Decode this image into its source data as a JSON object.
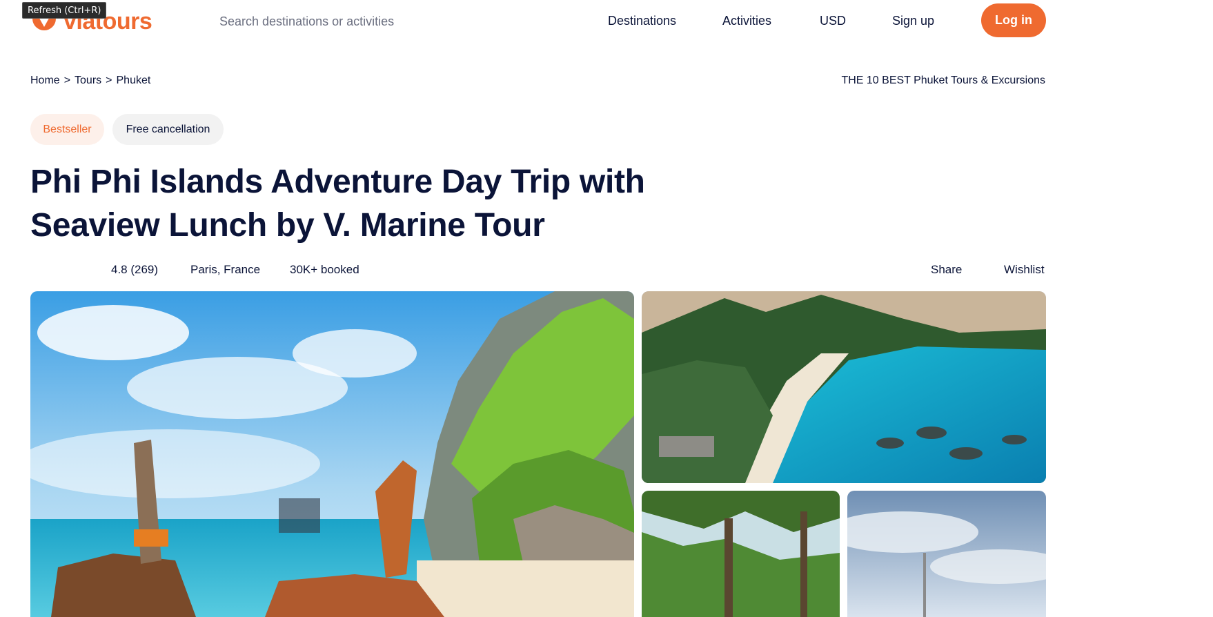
{
  "browser": {
    "tooltip": "Refresh (Ctrl+R)"
  },
  "header": {
    "logo_text": "viatours",
    "search_placeholder": "Search destinations or activities",
    "nav": {
      "destinations": "Destinations",
      "activities": "Activities",
      "currency": "USD",
      "signup": "Sign up",
      "login": "Log in"
    }
  },
  "breadcrumb": {
    "items": [
      "Home",
      "Tours",
      "Phuket"
    ],
    "separator": ">"
  },
  "top_link": "THE 10 BEST Phuket Tours & Excursions",
  "badges": {
    "bestseller": "Bestseller",
    "free_cancellation": "Free cancellation"
  },
  "tour": {
    "title": "Phi Phi Islands Adventure Day Trip with Seaview Lunch by V. Marine Tour",
    "rating_text": "4.8 (269)",
    "location": "Paris, France",
    "booked": "30K+ booked",
    "actions": {
      "share": "Share",
      "wishlist": "Wishlist"
    }
  },
  "colors": {
    "accent": "#ef6a30",
    "text": "#0b1438",
    "badge_best_bg": "#fdf0ea",
    "badge_free_bg": "#f2f2f2"
  },
  "gallery": [
    {
      "name": "main-photo",
      "subject": "longtail-boats-beach-cliff"
    },
    {
      "name": "top-right-photo",
      "subject": "aerial-beach-bay"
    },
    {
      "name": "bottom-left-photo",
      "subject": "trees-jungle"
    },
    {
      "name": "bottom-right-photo",
      "subject": "sky-clouds"
    }
  ]
}
